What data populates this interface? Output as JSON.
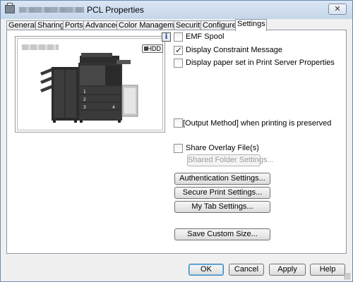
{
  "window": {
    "title": "PCL Properties",
    "close_glyph": "✕"
  },
  "tabs": [
    {
      "label": "General"
    },
    {
      "label": "Sharing"
    },
    {
      "label": "Ports"
    },
    {
      "label": "Advanced"
    },
    {
      "label": "Color Management"
    },
    {
      "label": "Security"
    },
    {
      "label": "Configure"
    },
    {
      "label": "Settings",
      "active": true
    }
  ],
  "preview": {
    "hdd_label": "HDD",
    "tray_numbers": [
      "1",
      "2",
      "3",
      "4"
    ]
  },
  "info_icon": "i",
  "options": {
    "emf_spool": {
      "label": "EMF Spool",
      "checked": false
    },
    "display_constraint": {
      "label": "Display Constraint Message",
      "checked": true
    },
    "display_paper_set": {
      "label": "Display paper set in Print Server Properties",
      "checked": false
    },
    "output_method": {
      "label": "[Output Method] when printing is preserved",
      "checked": false
    },
    "share_overlay": {
      "label": "Share Overlay File(s)",
      "checked": false
    }
  },
  "buttons": {
    "shared_folder": "Shared Folder Settings...",
    "authentication": "Authentication Settings...",
    "secure_print": "Secure Print Settings...",
    "my_tab": "My Tab Settings...",
    "save_custom_size": "Save Custom Size...",
    "ok": "OK",
    "cancel": "Cancel",
    "apply": "Apply",
    "help": "Help"
  }
}
